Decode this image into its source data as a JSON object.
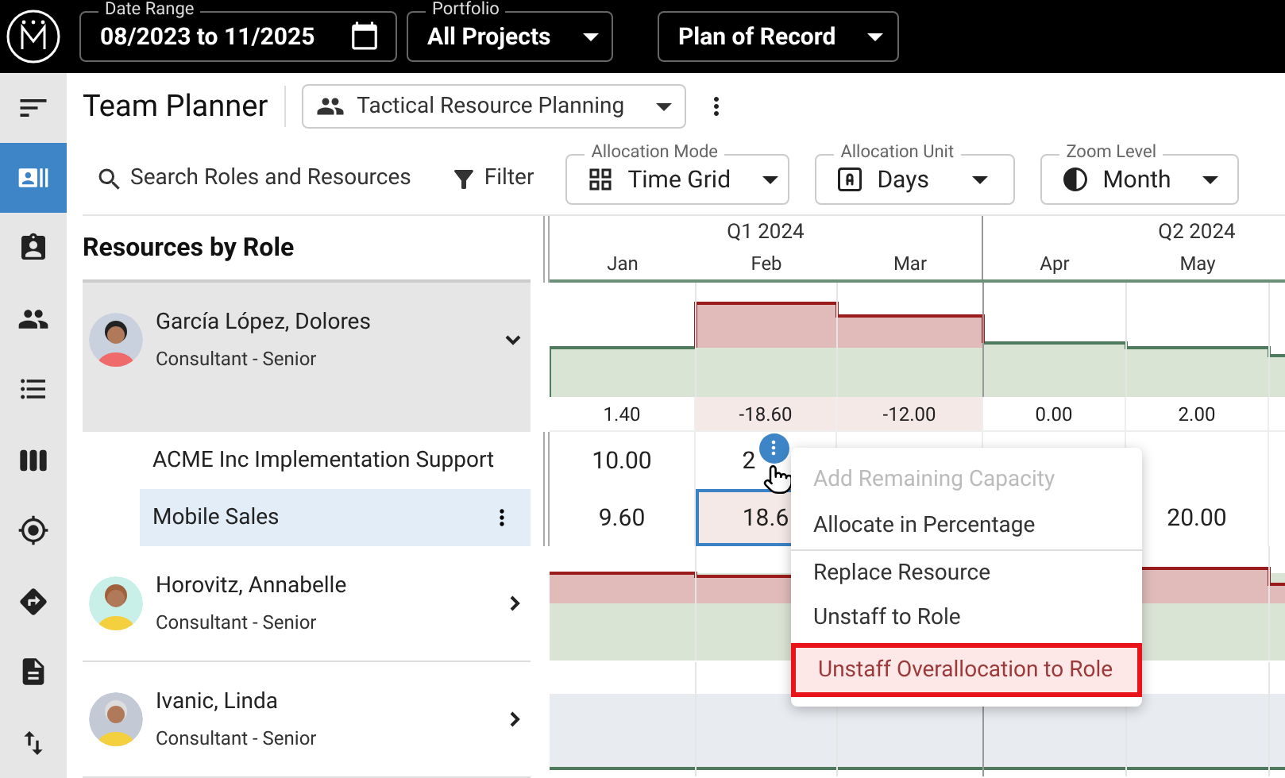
{
  "top_bar": {
    "date_range": {
      "label": "Date Range",
      "value": "08/2023 to 11/2025"
    },
    "portfolio": {
      "label": "Portfolio",
      "value": "All Projects"
    },
    "plan": {
      "value": "Plan of Record"
    }
  },
  "sidebar": {
    "items": [
      {
        "selected": true
      },
      {
        "selected": false
      },
      {
        "selected": false
      },
      {
        "selected": false
      },
      {
        "selected": false
      },
      {
        "selected": false
      },
      {
        "selected": false
      },
      {
        "selected": false
      },
      {
        "selected": false
      }
    ]
  },
  "page": {
    "title": "Team Planner",
    "view": "Tactical Resource Planning"
  },
  "toolbar": {
    "search": "Search Roles and Resources",
    "filter": "Filter",
    "allocation_mode": {
      "label": "Allocation Mode",
      "value": "Time Grid"
    },
    "allocation_unit": {
      "label": "Allocation Unit",
      "value": "Days"
    },
    "zoom_level": {
      "label": "Zoom Level",
      "value": "Month"
    }
  },
  "grid": {
    "title": "Resources by Role",
    "quarters": [
      {
        "label": "Q1 2024",
        "months": [
          "Jan",
          "Feb",
          "Mar"
        ]
      },
      {
        "label": "Q2 2024",
        "months": [
          "Apr",
          "May"
        ]
      }
    ],
    "resources": [
      {
        "name": "García López, Dolores",
        "role": "Consultant - Senior",
        "expanded": true,
        "chart": {
          "kind": "overallocated"
        },
        "balance": [
          {
            "value": "1.40",
            "over": false
          },
          {
            "value": "-18.60",
            "over": true
          },
          {
            "value": "-12.00",
            "over": true
          },
          {
            "value": "0.00",
            "over": false
          },
          {
            "value": "2.00",
            "over": false
          }
        ],
        "assignments": [
          {
            "name": "ACME Inc Implementation Support",
            "selected": false,
            "cells": [
              {
                "value": "10.00",
                "selected": false,
                "over": false,
                "hovered": false
              },
              {
                "value": "2",
                "selected": false,
                "over": false,
                "hovered": true
              },
              null,
              null,
              null
            ]
          },
          {
            "name": "Mobile Sales",
            "selected": true,
            "cells": [
              {
                "value": "9.60",
                "selected": false,
                "over": false
              },
              {
                "value": "18.6",
                "selected": true,
                "over": true
              },
              null,
              null,
              {
                "value": "20.00",
                "selected": false,
                "over": false
              }
            ]
          }
        ]
      },
      {
        "name": "Horovitz, Annabelle",
        "role": "Consultant - Senior",
        "expanded": false,
        "chart": {
          "kind": "overallocated_flat"
        }
      },
      {
        "name": "Ivanic, Linda",
        "role": "Consultant - Senior",
        "expanded": false,
        "chart": {
          "kind": "unallocated"
        }
      }
    ]
  },
  "context_menu": {
    "items": [
      {
        "label": "Add Remaining Capacity",
        "disabled": true,
        "selected": false,
        "separator_before": false
      },
      {
        "label": "Allocate in Percentage",
        "disabled": false,
        "selected": false,
        "separator_before": false
      },
      {
        "label": "Replace Resource",
        "disabled": false,
        "selected": false,
        "separator_before": true
      },
      {
        "label": "Unstaff to Role",
        "disabled": false,
        "selected": false,
        "separator_before": false
      },
      {
        "label": "Unstaff Overallocation to Role",
        "disabled": false,
        "selected": true,
        "separator_before": false
      }
    ]
  }
}
